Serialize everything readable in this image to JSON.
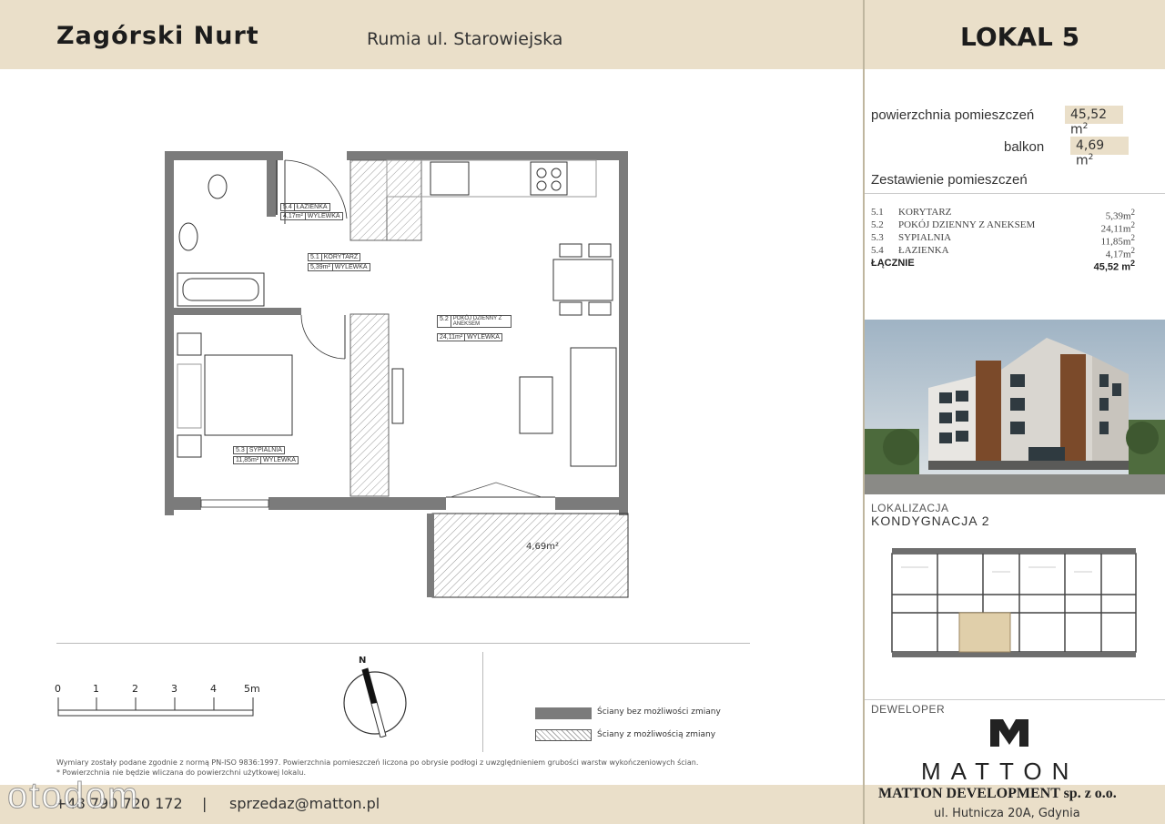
{
  "header": {
    "project": "Zagórski Nurt",
    "address": "Rumia ul. Starowiejska",
    "unit": "LOKAL 5"
  },
  "summary": {
    "area_label": "powierzchnia pomieszczeń",
    "area_value": "45,52 m",
    "balcony_label": "balkon",
    "balcony_value": "4,69 m",
    "rooms_heading": "Zestawienie pomieszczeń"
  },
  "rooms": [
    {
      "num": "5.1",
      "name": "KORYTARZ",
      "area": "5,39m"
    },
    {
      "num": "5.2",
      "name": "POKÓJ DZIENNY Z ANEKSEM",
      "area": "24,11m"
    },
    {
      "num": "5.3",
      "name": "SYPIALNIA",
      "area": "11,85m"
    },
    {
      "num": "5.4",
      "name": "ŁAZIENKA",
      "area": "4,17m"
    }
  ],
  "total": {
    "label": "ŁĄCZNIE",
    "value": "45,52 m"
  },
  "location": {
    "label": "LOKALIZACJA",
    "floor": "KONDYGNACJA 2"
  },
  "developer": {
    "label": "DEWELOPER",
    "logo": "MATTON",
    "company": "MATTON DEVELOPMENT sp. z o.o.",
    "address": "ul. Hutnicza 20A, Gdynia"
  },
  "plan_tags": {
    "t54": {
      "num": "5.4",
      "name": "ŁAZIENKA",
      "area": "4,17m²",
      "floor": "WYLEWKA"
    },
    "t51": {
      "num": "5.1",
      "name": "KORYTARZ",
      "area": "5,39m²",
      "floor": "WYLEWKA"
    },
    "t52": {
      "num": "5.2",
      "name": "POKÓJ DZIENNY Z ANEKSEM",
      "area": "24,11m²",
      "floor": "WYLEWKA"
    },
    "t53": {
      "num": "5.3",
      "name": "SYPIALNIA",
      "area": "11,85m²",
      "floor": "WYLEWKA"
    },
    "balcony": "4,69m²"
  },
  "scale": {
    "ticks": [
      "0",
      "1",
      "2",
      "3",
      "4",
      "5m"
    ]
  },
  "compass": {
    "north": "N"
  },
  "legend": {
    "solid": "Ściany bez możliwości zmiany",
    "hatched": "Ściany z możliwością zmiany"
  },
  "notes": {
    "line1": "Wymiary zostały podane zgodnie z normą PN-ISO 9836:1997. Powierzchnia pomieszczeń liczona po obrysie podłogi z uwzględnieniem grubości warstw wykończeniowych ścian.",
    "line2": "* Powierzchnia nie będzie wliczana do powierzchni użytkowej lokalu."
  },
  "contact": {
    "phone": "+48 790 720 172",
    "sep": "|",
    "email": "sprzedaz@matton.pl"
  },
  "watermark": "otodom"
}
